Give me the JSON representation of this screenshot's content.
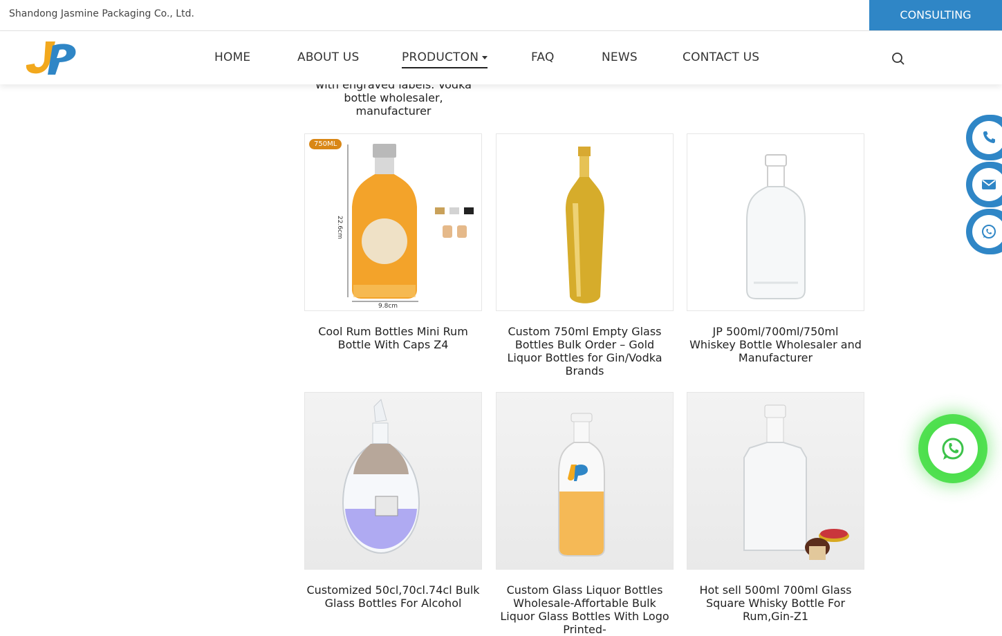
{
  "topbar": {
    "company_name": "Shandong Jasmine Packaging Co., Ltd.",
    "consult_label": "CONSULTING"
  },
  "nav": {
    "items": [
      {
        "label": "HOME"
      },
      {
        "label": "ABOUT US"
      },
      {
        "label": "PRODUCTON"
      },
      {
        "label": "FAQ"
      },
      {
        "label": "NEWS"
      },
      {
        "label": "CONTACT US"
      }
    ],
    "active": "PRODUCTON"
  },
  "partial_product": {
    "title": "with engraved labels. Vodka bottle wholesaler, manufacturer"
  },
  "products": [
    {
      "title": "Cool Rum Bottles Mini Rum Bottle With Caps Z4",
      "badge": "750ML",
      "height_label": "22.6cm",
      "width_label": "9.8cm"
    },
    {
      "title": "Custom 750ml Empty Glass Bottles Bulk Order – Gold Liquor Bottles for Gin/Vodka Brands"
    },
    {
      "title": "JP 500ml/700ml/750ml Whiskey Bottle Wholesaler and Manufacturer"
    },
    {
      "title": "Customized 50cl,70cl.74cl Bulk Glass Bottles For Alcohol"
    },
    {
      "title": "Custom Glass Liquor Bottles Wholesale-Affortable Bulk Liquor Glass Bottles With Logo Printed-"
    },
    {
      "title": "Hot sell 500ml 700ml Glass Square Whisky Bottle For Rum,Gin-Z1"
    }
  ],
  "side_icons": [
    "phone-icon",
    "mail-icon",
    "whatsapp-icon"
  ],
  "colors": {
    "accent": "#2f86c6",
    "whatsapp_glow": "#3cdc3c",
    "logo_orange": "#f2a81d"
  }
}
